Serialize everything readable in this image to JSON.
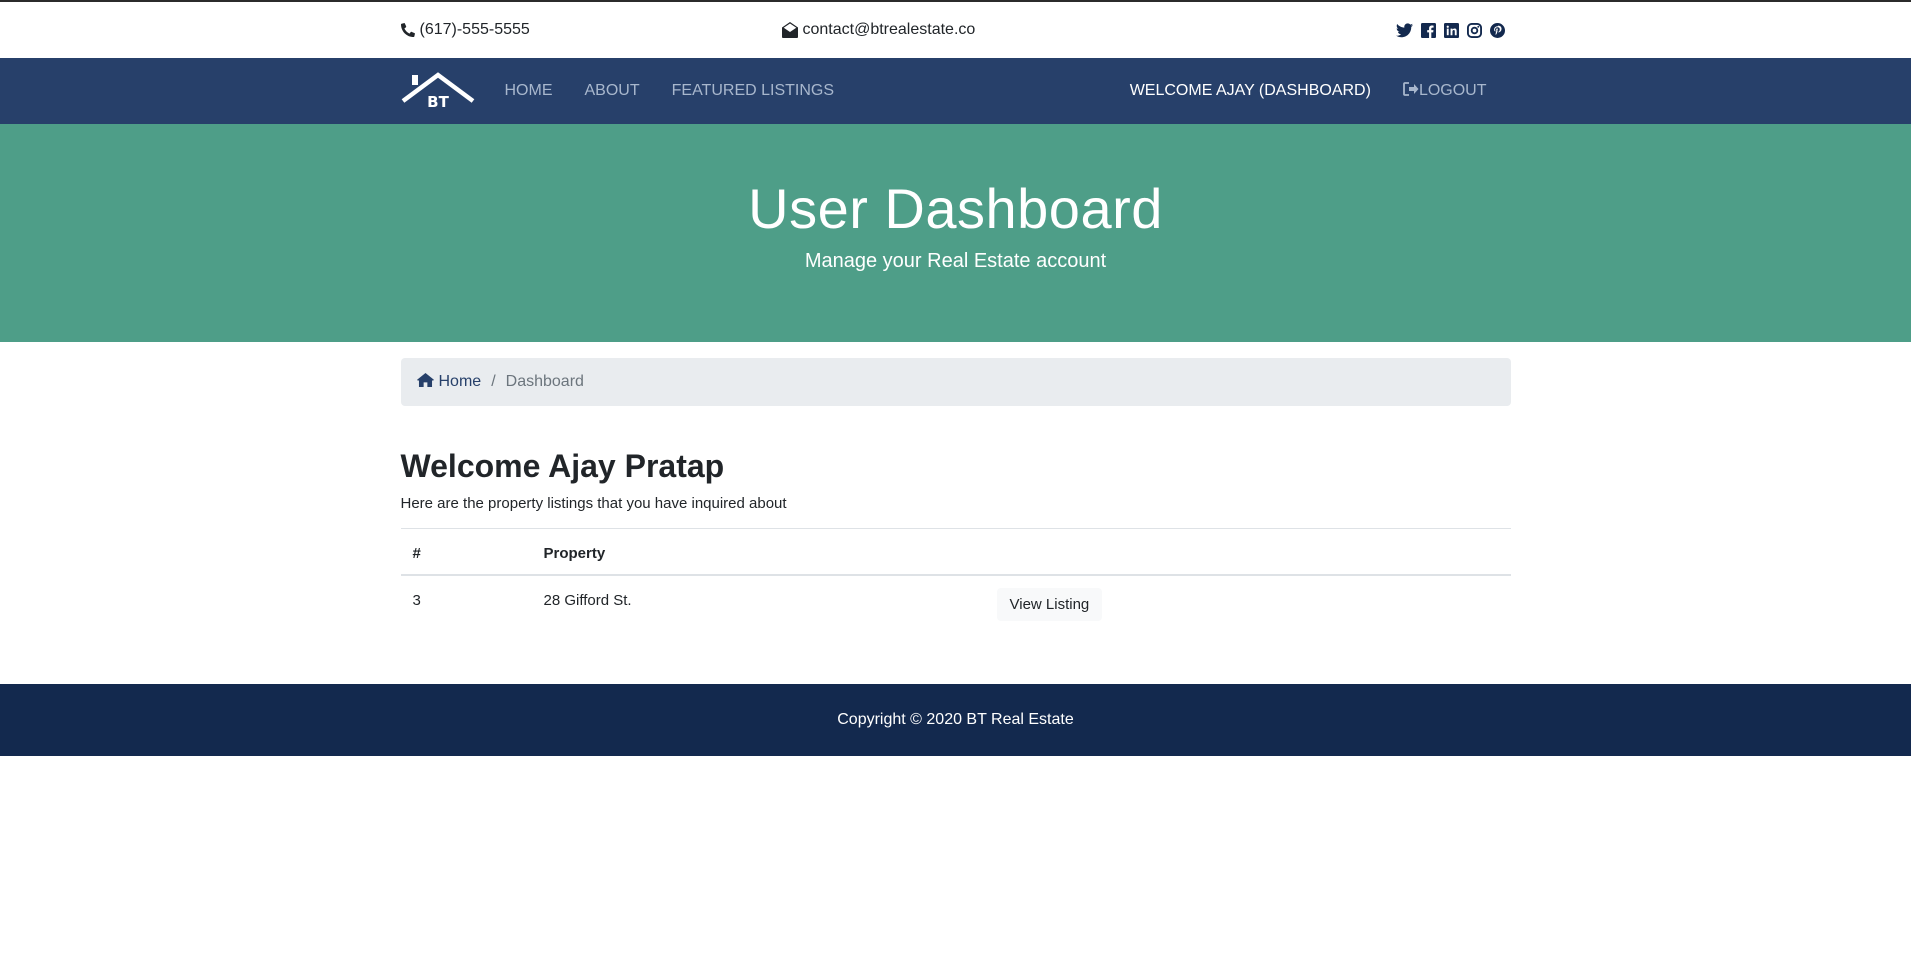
{
  "topbar": {
    "phone": "(617)-555-5555",
    "email": "contact@btrealestate.co",
    "social_icons": [
      "twitter-icon",
      "facebook-icon",
      "linkedin-icon",
      "instagram-icon",
      "pinterest-icon"
    ]
  },
  "navbar": {
    "brand": "BT",
    "links": [
      "HOME",
      "ABOUT",
      "FEATURED LISTINGS"
    ],
    "welcome": "WELCOME AJAY (DASHBOARD)",
    "logout": "LOGOUT"
  },
  "hero": {
    "title": "User Dashboard",
    "subtitle": "Manage your Real Estate account"
  },
  "breadcrumb": {
    "home": "Home",
    "separator": "/",
    "current": "Dashboard"
  },
  "main": {
    "title": "Welcome Ajay Pratap",
    "subtitle": "Here are the property listings that you have inquired about",
    "table": {
      "headers": [
        "#",
        "Property",
        ""
      ],
      "rows": [
        {
          "num": "3",
          "property": "28 Gifford St.",
          "action": "View Listing"
        }
      ]
    }
  },
  "footer": {
    "copyright": "Copyright © 2020 BT Real Estate"
  },
  "colors": {
    "navbar": "#27406a",
    "hero": "#4e9e88",
    "footer": "#13294e",
    "breadcrumb_bg": "#e9ecef"
  }
}
